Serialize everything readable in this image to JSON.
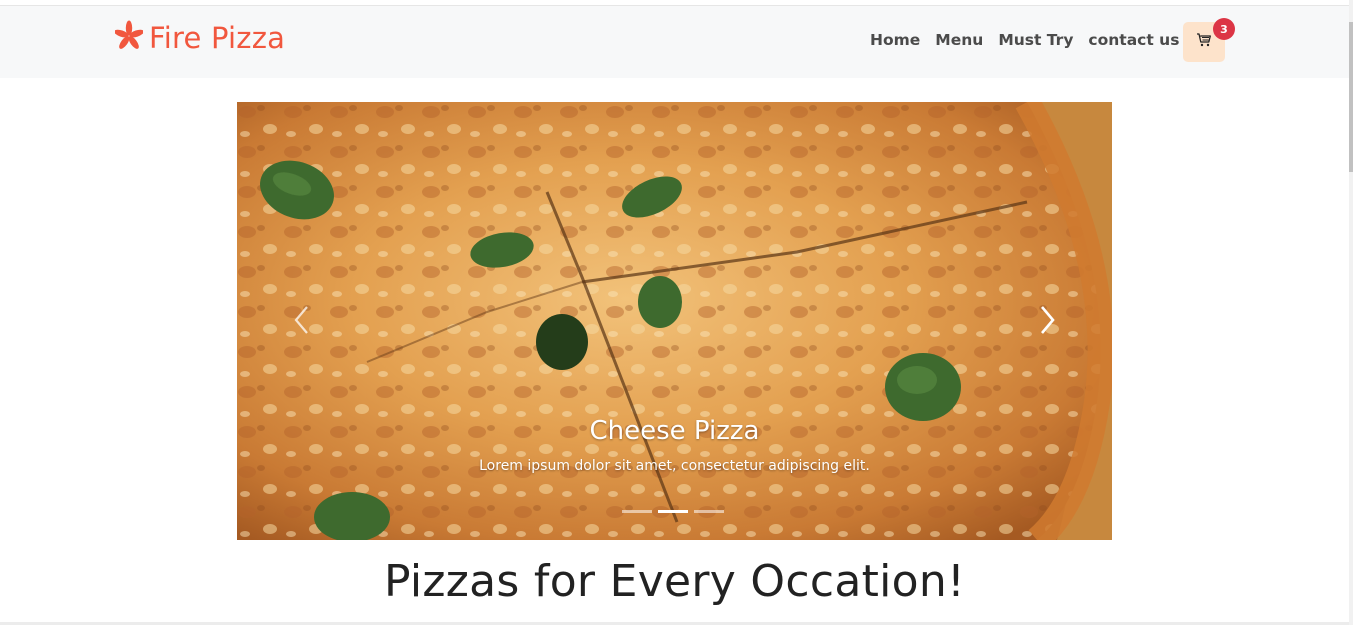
{
  "brand": {
    "name": "Fire Pizza",
    "icon": "flame-asterisk-icon",
    "color": "#f1573e"
  },
  "nav": {
    "items": [
      {
        "label": "Home"
      },
      {
        "label": "Menu"
      },
      {
        "label": "Must Try"
      },
      {
        "label": "contact us"
      }
    ]
  },
  "cart": {
    "icon": "cart-icon",
    "count": "3",
    "badge_color": "#dc3545",
    "button_color": "#fde3cb"
  },
  "carousel": {
    "slides": [
      {
        "title": "Cheese Pizza",
        "text": "Lorem ipsum dolor sit amet, consectetur adipiscing elit."
      }
    ],
    "prev_icon": "chevron-left-icon",
    "next_icon": "chevron-right-icon",
    "indicator_count": 3,
    "active_indicator": 1
  },
  "section": {
    "heading": "Pizzas for Every Occation!"
  }
}
